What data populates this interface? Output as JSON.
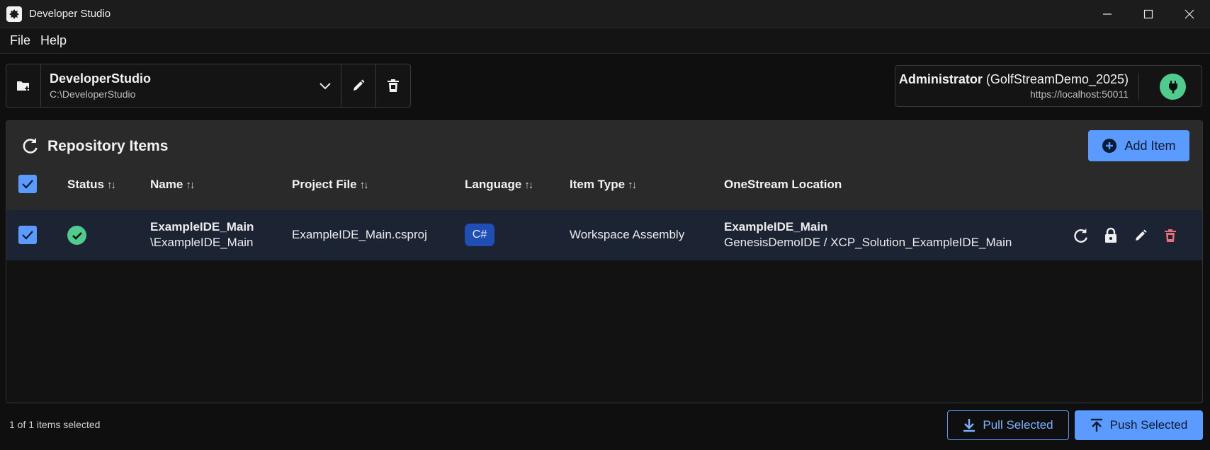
{
  "window": {
    "title": "Developer Studio"
  },
  "menu": {
    "file": "File",
    "help": "Help"
  },
  "project": {
    "name": "DeveloperStudio",
    "path": "C:\\DeveloperStudio"
  },
  "connection": {
    "user": "Administrator",
    "app": "(GolfStreamDemo_2025)",
    "url": "https://localhost:50011"
  },
  "repository": {
    "title": "Repository Items",
    "add_label": "Add Item",
    "columns": {
      "status": "Status",
      "name": "Name",
      "project_file": "Project File",
      "language": "Language",
      "item_type": "Item Type",
      "location": "OneStream Location"
    },
    "sort_glyph": "↑↓",
    "rows": [
      {
        "name": "ExampleIDE_Main",
        "name_path": "\\ExampleIDE_Main",
        "project_file": "ExampleIDE_Main.csproj",
        "language": "C#",
        "item_type": "Workspace Assembly",
        "location_title": "ExampleIDE_Main",
        "location_path": "GenesisDemoIDE / XCP_Solution_ExampleIDE_Main"
      }
    ]
  },
  "footer": {
    "selection": "1 of 1 items selected",
    "pull_label": "Pull Selected",
    "push_label": "Push Selected"
  },
  "colors": {
    "accent": "#5b9bff",
    "success": "#4ecb8d",
    "danger": "#e5707a",
    "row_selected": "#1c2333"
  }
}
